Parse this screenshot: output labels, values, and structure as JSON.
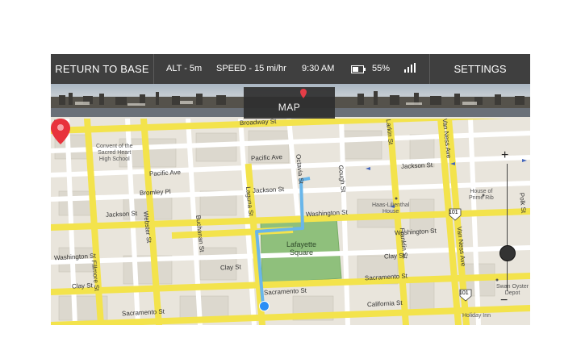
{
  "topbar": {
    "return_label": "RETURN TO BASE",
    "alt": "ALT - 5m",
    "speed": "SPEED - 15 mi/hr",
    "time": "9:30 AM",
    "battery_percent": "55%",
    "battery_level": 0.55,
    "settings_label": "SETTINGS",
    "icons": [
      "battery-icon",
      "signal-icon"
    ]
  },
  "panorama": {
    "map_tab_label": "MAP"
  },
  "map": {
    "streets": {
      "broadway": "Broadway St",
      "pacific_ave_left": "Pacific Ave",
      "pacific_ave_mid": "Pacific Ave",
      "jackson_left": "Jackson St",
      "jackson_mid": "Jackson St",
      "jackson_right": "Jackson St",
      "washington_left": "Washington St",
      "washington_mid": "Washington St",
      "washington_right": "Washington St",
      "clay_left": "Clay St",
      "clay_mid": "Clay St",
      "clay_right": "Clay St",
      "sacramento_left": "Sacramento St",
      "sacramento_mid": "Sacramento St",
      "sacramento_right": "Sacramento St",
      "california": "California St",
      "bromley": "Bromley Pl",
      "fillmore": "Fillmore St",
      "webster": "Webster St",
      "buchanan": "Buchanan St",
      "laguna": "Laguna St",
      "octavia": "Octavia St",
      "gough": "Gough St",
      "franklin": "Franklin St",
      "van_ness": "Van Ness Ave",
      "polk": "Polk St",
      "larkin": "Larkin St"
    },
    "pois": {
      "convent": "Convent of the\nSacred Heart\nHigh School",
      "haas": "Haas-Lilienthal\nHouse",
      "house_of": "House of\nPrime Rib",
      "swan": "Swan Oyster\nDepot",
      "holiday_inn": "Holiday Inn"
    },
    "park": "Lafayette\nSquare",
    "shields": [
      "101",
      "101",
      "101"
    ],
    "zoom": {
      "plus": "+",
      "minus": "−"
    },
    "colors": {
      "road": "#f3e34c",
      "route": "#69b6ea",
      "park": "#8fc07c",
      "pin": "#e8323c",
      "user_dot": "#2a8ef5"
    }
  }
}
